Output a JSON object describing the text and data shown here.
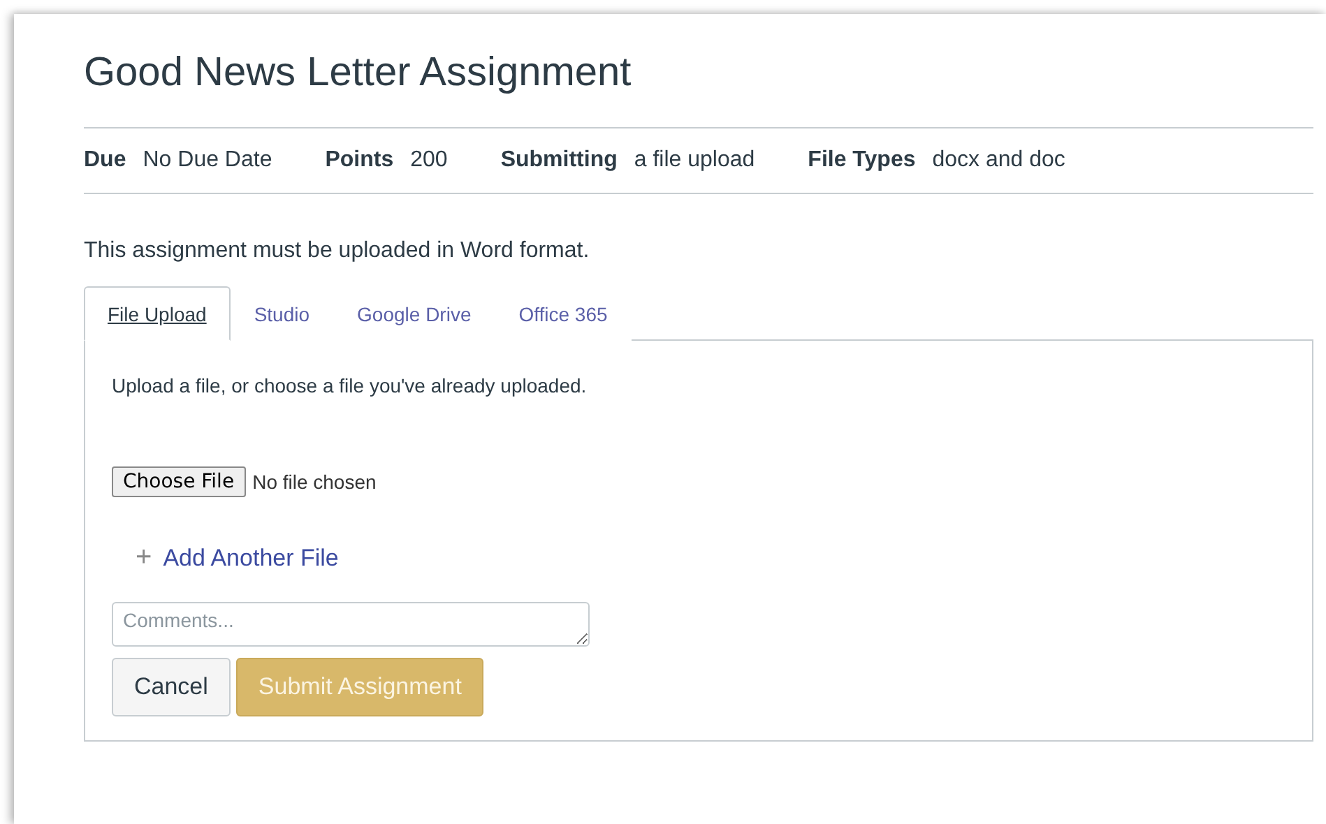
{
  "title": "Good News Letter Assignment",
  "details": [
    {
      "label": "Due",
      "value": "No Due Date"
    },
    {
      "label": "Points",
      "value": "200"
    },
    {
      "label": "Submitting",
      "value": "a file upload"
    },
    {
      "label": "File Types",
      "value": "docx and doc"
    }
  ],
  "instruction": "This assignment must be uploaded in Word format.",
  "tabs": [
    {
      "label": "File Upload",
      "selected": true
    },
    {
      "label": "Studio",
      "selected": false
    },
    {
      "label": "Google Drive",
      "selected": false
    },
    {
      "label": "Office 365",
      "selected": false
    }
  ],
  "upload": {
    "hint": "Upload a file, or choose a file you've already uploaded.",
    "choose_button": "Choose File",
    "file_status": "No file chosen",
    "add_icon": "+",
    "add_link": "Add Another File"
  },
  "comments": {
    "placeholder": "Comments..."
  },
  "buttons": {
    "cancel": "Cancel",
    "submit": {
      "label": "Submit Assignment",
      "disabled": true
    }
  }
}
